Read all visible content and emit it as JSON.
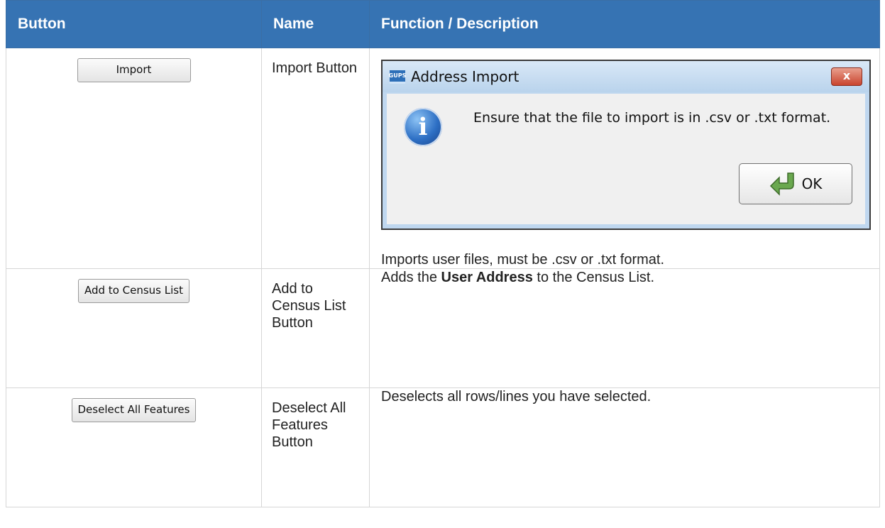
{
  "headers": [
    "Button",
    "Name",
    "Function / Description"
  ],
  "rows": [
    {
      "button_label": "Import",
      "name": "Import Button",
      "dialog": {
        "title": "Address Import",
        "app_icon_text": "GUPS",
        "close_label": "x",
        "message": "Ensure that the file to import is in .csv or .txt format.",
        "ok_label": "OK"
      },
      "description": "Imports user files, must be .csv or .txt format."
    },
    {
      "button_label": "Add to Census List",
      "name": "Add to Census List Button",
      "description_before": "Adds the ",
      "description_bold": "User Address",
      "description_after": " to the Census List."
    },
    {
      "button_label": "Deselect All Features",
      "name": "Deselect All Features Button",
      "description": "Deselects all rows/lines you have selected."
    }
  ]
}
